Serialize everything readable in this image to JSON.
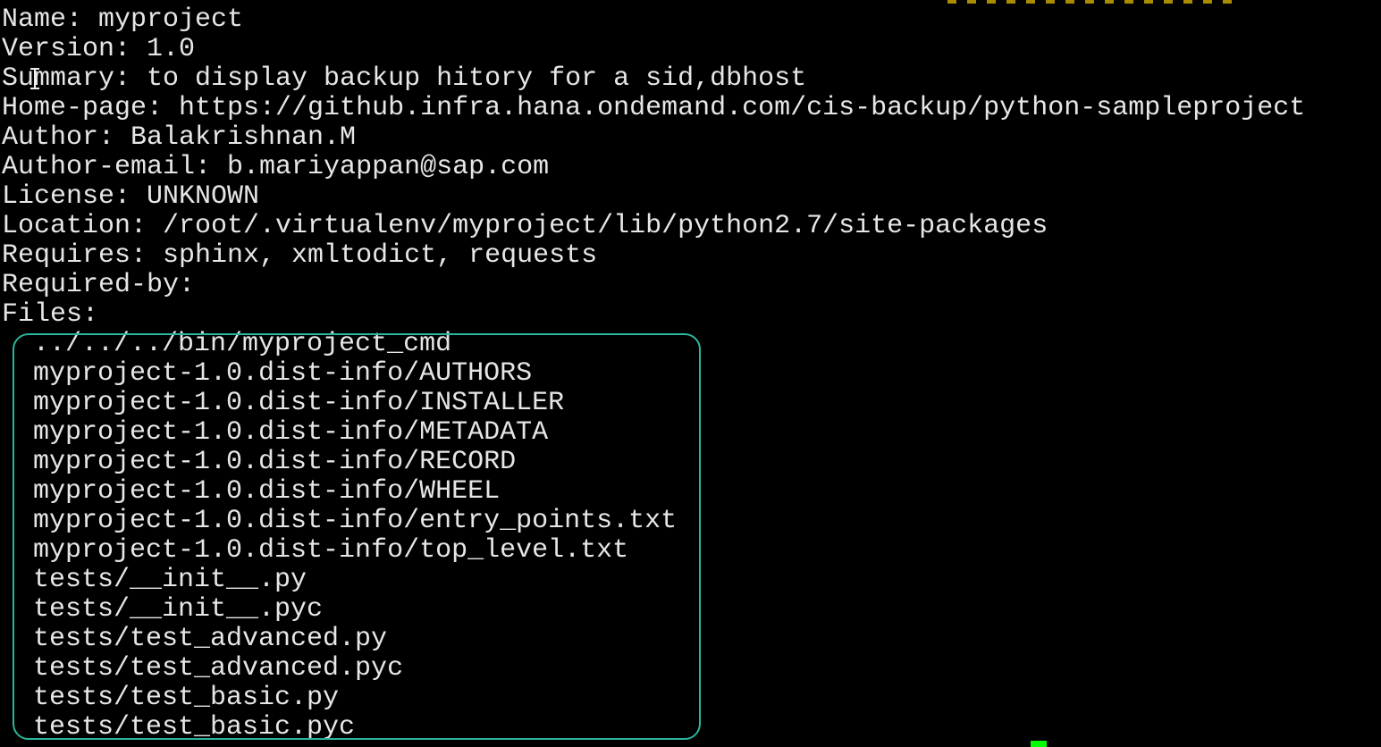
{
  "terminal": {
    "info_lines": [
      "Name: myproject",
      "Version: 1.0",
      "Summary: to display backup hitory for a sid,dbhost",
      "Home-page: https://github.infra.hana.ondemand.com/cis-backup/python-sampleproject",
      "Author: Balakrishnan.M",
      "Author-email: b.mariyappan@sap.com",
      "License: UNKNOWN",
      "Location: /root/.virtualenv/myproject/lib/python2.7/site-packages",
      "Requires: sphinx, xmltodict, requests",
      "Required-by:",
      "Files:"
    ],
    "files": [
      "../../../bin/myproject_cmd",
      "myproject-1.0.dist-info/AUTHORS",
      "myproject-1.0.dist-info/INSTALLER",
      "myproject-1.0.dist-info/METADATA",
      "myproject-1.0.dist-info/RECORD",
      "myproject-1.0.dist-info/WHEEL",
      "myproject-1.0.dist-info/entry_points.txt",
      "myproject-1.0.dist-info/top_level.txt",
      "tests/__init__.py",
      "tests/__init__.pyc",
      "tests/test_advanced.py",
      "tests/test_advanced.pyc",
      "tests/test_basic.py",
      "tests/test_basic.pyc"
    ]
  },
  "colors": {
    "background": "#000000",
    "text": "#e6e6e6",
    "highlight_border": "#2bb59a",
    "cursor": "#00ff00"
  }
}
